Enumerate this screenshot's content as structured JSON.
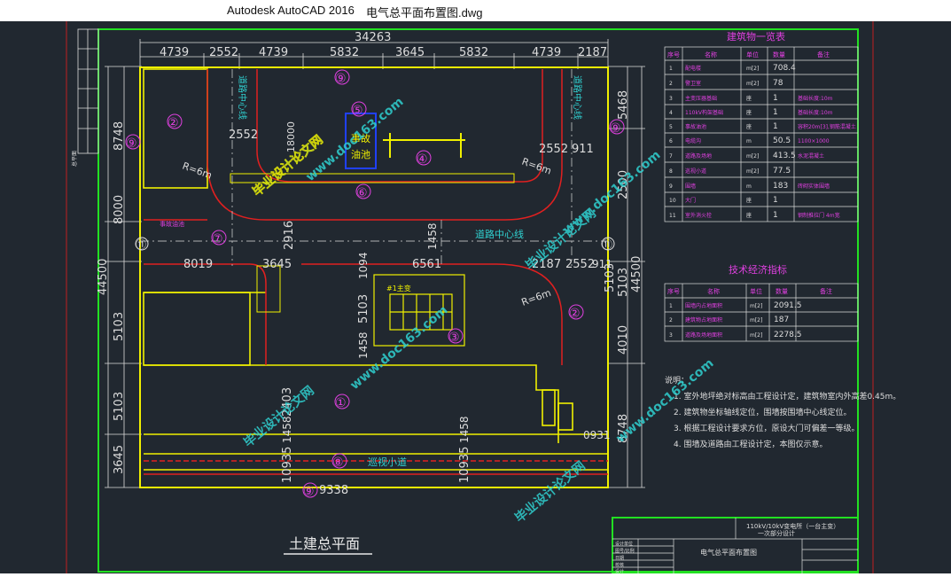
{
  "window": {
    "app_name": "Autodesk AutoCAD 2016",
    "file_name": "电气总平面布置图.dwg"
  },
  "colors": {
    "background": "#212830",
    "frame": "#22e022",
    "building": "#f0f000",
    "road": "#e02020",
    "dimension": "#e0e0e0",
    "magenta": "#e040e0",
    "cyan": "#30d0d0"
  },
  "dimensions": {
    "top_total": "34263",
    "top_segments": [
      "4739",
      "2552",
      "4739",
      "5832",
      "3645",
      "5832",
      "4739",
      "2187"
    ],
    "left": [
      "8748",
      "8000",
      "44500",
      "5103",
      "5103",
      "3645"
    ],
    "right": [
      "5468",
      "2500",
      "44500",
      "5103",
      "4010",
      "8748"
    ],
    "inner": [
      "2552",
      "18000",
      "2552",
      "911",
      "2916",
      "3645",
      "8019",
      "3645",
      "1094",
      "6561",
      "1458",
      "2552",
      "911",
      "5103",
      "1458",
      "5103",
      "2187",
      "2403",
      "10935",
      "1458",
      "10935",
      "1458",
      "0931",
      "9338",
      "5468"
    ]
  },
  "labels": {
    "road_centerline": "道路中心线",
    "road_centerline_top_left": "道路中心线",
    "road_centerline_top_right": "道路中心线",
    "patrol_road": "巡视小道",
    "radius_1": "R=6m",
    "radius_2": "R=6m",
    "radius_3": "R=6m",
    "oil_pool": "事故\n油池",
    "main_transformer": "#1主变",
    "left_note": "事故油池",
    "side_label": "总平面"
  },
  "zone_numbers": [
    "①",
    "②",
    "③",
    "④",
    "⑤",
    "⑥",
    "⑦",
    "⑧",
    "⑨",
    "⑨",
    "⑨",
    "⑨",
    "⑪",
    "⑪",
    "②"
  ],
  "building_table": {
    "title": "建筑物一览表",
    "headers": [
      "序号",
      "名称",
      "单位",
      "数量",
      "备注"
    ],
    "rows": [
      [
        "1",
        "配电楼",
        "m[2]",
        "708.4",
        ""
      ],
      [
        "2",
        "警卫室",
        "m[2]",
        "78",
        ""
      ],
      [
        "3",
        "主变压器基础",
        "座",
        "1",
        "基础长度:10m"
      ],
      [
        "4",
        "110kV构架基础",
        "座",
        "1",
        "基础长度:10m"
      ],
      [
        "5",
        "事故油池",
        "座",
        "1",
        "容积20m[3],钢筋混凝土"
      ],
      [
        "6",
        "电缆沟",
        "m",
        "50.5",
        "1100×1000"
      ],
      [
        "7",
        "道路及场地",
        "m[2]",
        "413.5",
        "水泥混凝土"
      ],
      [
        "8",
        "巡视小道",
        "m[2]",
        "77.5",
        ""
      ],
      [
        "9",
        "围墙",
        "m",
        "183",
        "砖砌实体围墙"
      ],
      [
        "10",
        "大门",
        "座",
        "1",
        ""
      ],
      [
        "11",
        "室外消火栓",
        "座",
        "1",
        "钢制推拉门 4m宽"
      ]
    ]
  },
  "tech_table": {
    "title": "技术经济指标",
    "headers": [
      "序号",
      "名称",
      "单位",
      "数量",
      "备注"
    ],
    "rows": [
      [
        "1",
        "围墙内占地面积",
        "m[2]",
        "2091.5",
        ""
      ],
      [
        "2",
        "建筑物占地面积",
        "m[2]",
        "187",
        ""
      ],
      [
        "3",
        "道路及场地面积",
        "m[2]",
        "2278.5",
        ""
      ]
    ]
  },
  "notes": {
    "title": "说明：",
    "items": [
      "1. 室外地坪绝对标高由工程设计定，建筑物室内外高差0.45m。",
      "2. 建筑物坐标轴线定位，围墙按围墙中心线定位。",
      "3. 根据工程设计要求方位，原设大门可偏差一等级。",
      "4. 围墙及道路由工程设计定，本图仅示意。"
    ]
  },
  "drawing_title": "土建总平面",
  "title_block": {
    "project": "110kV/10kV变电所（一台主变）",
    "subtitle": "一次部分设计",
    "drawing_name": "电气总平面布置图",
    "left_cells": [
      "设计单位",
      "图号/比例",
      "日期",
      "校核",
      "设计"
    ]
  },
  "watermarks": [
    "毕业设计论文网",
    "www.doc163.com"
  ]
}
